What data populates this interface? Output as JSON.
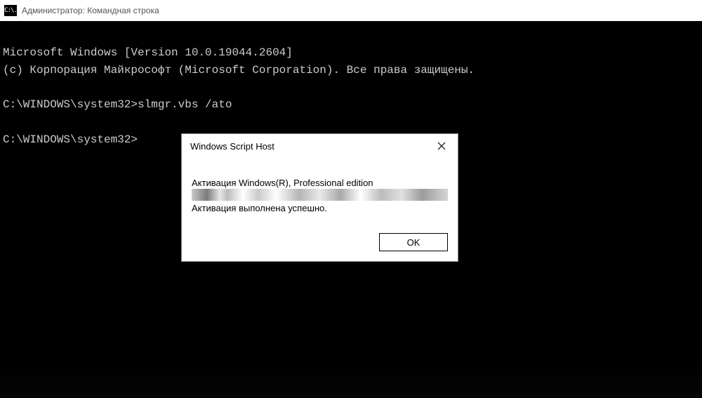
{
  "titlebar": {
    "icon_text": "C:\\.",
    "title": "Администратор: Командная строка"
  },
  "console": {
    "line1": "Microsoft Windows [Version 10.0.19044.2604]",
    "line2": "(c) Корпорация Майкрософт (Microsoft Corporation). Все права защищены.",
    "blank1": "",
    "line3": "C:\\WINDOWS\\system32>slmgr.vbs /ato",
    "blank2": "",
    "line4": "C:\\WINDOWS\\system32>"
  },
  "dialog": {
    "title": "Windows Script Host",
    "heading": "Активация Windows(R), Professional edition",
    "message": "Активация выполнена успешно.",
    "ok_label": "OK"
  }
}
